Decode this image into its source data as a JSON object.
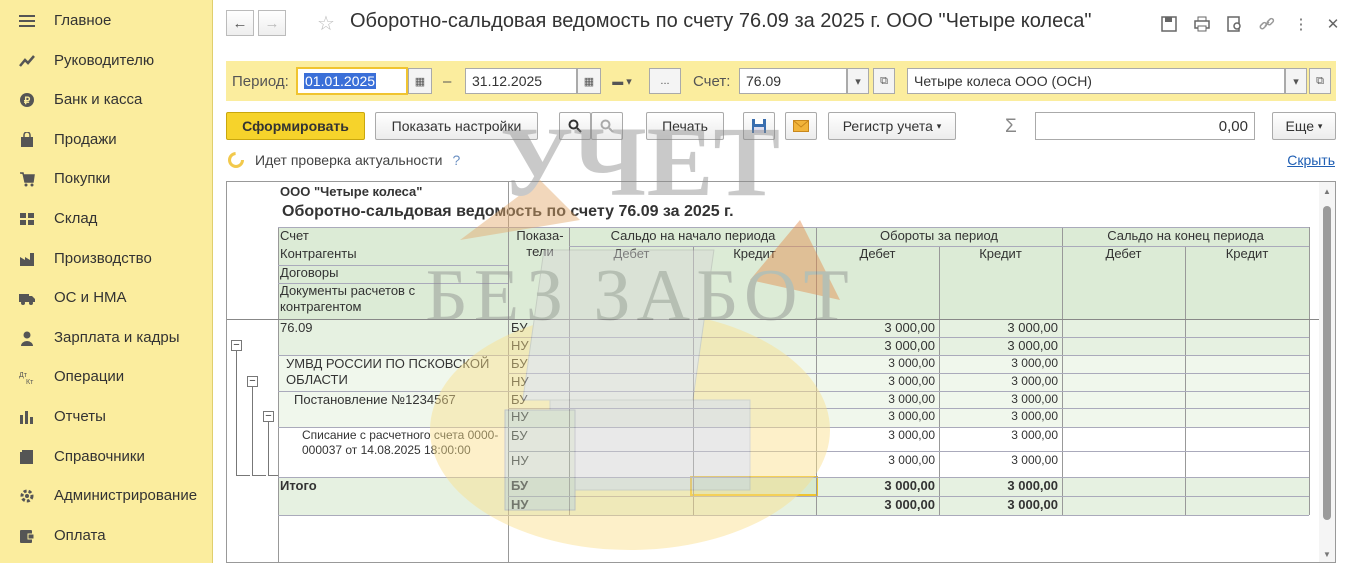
{
  "sidebar": {
    "items": [
      {
        "label": "Главное",
        "icon": "menu-icon"
      },
      {
        "label": "Руководителю",
        "icon": "trend-icon"
      },
      {
        "label": "Банк и касса",
        "icon": "coin-icon"
      },
      {
        "label": "Продажи",
        "icon": "bag-icon"
      },
      {
        "label": "Покупки",
        "icon": "cart-icon"
      },
      {
        "label": "Склад",
        "icon": "warehouse-icon"
      },
      {
        "label": "Производство",
        "icon": "factory-icon"
      },
      {
        "label": "ОС и НМА",
        "icon": "truck-icon"
      },
      {
        "label": "Зарплата и кадры",
        "icon": "person-icon"
      },
      {
        "label": "Операции",
        "icon": "operations-icon"
      },
      {
        "label": "Отчеты",
        "icon": "chart-icon"
      },
      {
        "label": "Справочники",
        "icon": "book-icon"
      },
      {
        "label": "Администрирование",
        "icon": "gear-icon"
      },
      {
        "label": "Оплата",
        "icon": "wallet-icon"
      }
    ]
  },
  "header": {
    "title": "Оборотно-сальдовая ведомость по счету 76.09 за 2025 г. ООО \"Четыре колеса\""
  },
  "period_bar": {
    "period_label": "Период:",
    "date_from": "01.01.2025",
    "dash": "–",
    "date_to": "31.12.2025",
    "ellipsis": "...",
    "account_label": "Счет:",
    "account": "76.09",
    "organization": "Четыре колеса ООО (ОСН)"
  },
  "toolbar": {
    "generate": "Сформировать",
    "show_settings": "Показать настройки",
    "print": "Печать",
    "register": "Регистр учета",
    "sigma": "Σ",
    "sum_value": "0,00",
    "more": "Еще"
  },
  "status": {
    "text": "Идет проверка актуальности",
    "help": "?",
    "hide": "Скрыть"
  },
  "report": {
    "org": "ООО \"Четыре колеса\"",
    "title": "Оборотно-сальдовая ведомость по счету 76.09 за 2025 г.",
    "headers": {
      "account": "Счет",
      "contractors": "Контрагенты",
      "contracts": "Договоры",
      "documents": "Документы расчетов с контрагентом",
      "indicators": "Показа-\nтели",
      "opening": "Сальдо на начало периода",
      "turnover": "Обороты за период",
      "closing": "Сальдо на конец периода",
      "debit": "Дебет",
      "credit": "Кредит"
    },
    "rows": [
      {
        "name": "76.09",
        "lines": [
          {
            "ind": "БУ",
            "dt": "3 000,00",
            "kt": "3 000,00"
          },
          {
            "ind": "НУ",
            "dt": "3 000,00",
            "kt": "3 000,00"
          }
        ]
      },
      {
        "name": "УМВД РОССИИ ПО ПСКОВСКОЙ ОБЛАСТИ",
        "lines": [
          {
            "ind": "БУ",
            "dt": "3 000,00",
            "kt": "3 000,00"
          },
          {
            "ind": "НУ",
            "dt": "3 000,00",
            "kt": "3 000,00"
          }
        ]
      },
      {
        "name": "Постановление №1234567",
        "lines": [
          {
            "ind": "БУ",
            "dt": "3 000,00",
            "kt": "3 000,00"
          },
          {
            "ind": "НУ",
            "dt": "3 000,00",
            "kt": "3 000,00"
          }
        ]
      },
      {
        "name": "Списание с расчетного счета 0000-000037 от 14.08.2025 18:00:00",
        "lines": [
          {
            "ind": "БУ",
            "dt": "3 000,00",
            "kt": "3 000,00"
          },
          {
            "ind": "НУ",
            "dt": "3 000,00",
            "kt": "3 000,00"
          }
        ]
      }
    ],
    "total": {
      "name": "Итого",
      "lines": [
        {
          "ind": "БУ",
          "dt": "3 000,00",
          "kt": "3 000,00"
        },
        {
          "ind": "НУ",
          "dt": "3 000,00",
          "kt": "3 000,00"
        }
      ]
    }
  },
  "watermark": {
    "line1": "УЧЕТ",
    "line2": "БЕЗ ЗАБОТ"
  },
  "colors": {
    "sidebar_bg": "#fbed9e",
    "primary_button": "#f6d32b",
    "table_header": "#dcebd6",
    "link": "#1f5fb4"
  }
}
